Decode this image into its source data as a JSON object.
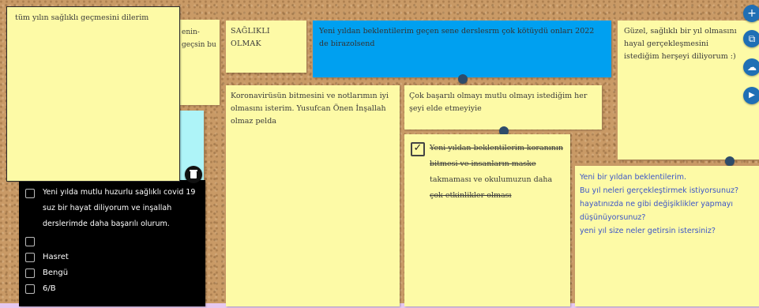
{
  "notes": {
    "top_left": "tüm yılın sağlıklı geçmesini dilerim",
    "behind_fragment_1": "enin-",
    "behind_fragment_2": "geçsin bu",
    "saglikli": "SAĞLIKLI OLMAK",
    "blue": "Yeni yıldan beklentilerim geçen sene derslesrm çok kötüydü  onları 2022 de birazolsend",
    "guzel": "Güzel, sağlıklı bir yıl olmasını hayal gerçekleşmesini istediğim herşeyi diliyorum :)",
    "korona": "Koronavirüsün bitmesini ve notlarımın iyi olmasını isterim.        Yusufcan Önen İnşallah olmaz pelda",
    "cok_basarili": "Çok başarılı olmayı mutlu olmayı istediğim her şeyi elde etmeyiyie",
    "checked_note": {
      "line1": "Yeni yıldan beklentilerim koranının",
      "line2": "bitmesi ve insanların maske",
      "line3": "takmaması ve okulumuzun daha",
      "line4": "çok etkinlikler olması"
    },
    "questions": {
      "q1": "Yeni bir yıldan beklentilerim.",
      "q2": "Bu yıl neleri gerçekleştirmek istiyorsunuz?",
      "q3": "hayatınızda ne gibi değişiklikler yapmayı düşünüyorsunuz?",
      "q4": "yeni yıl size neler getirsin istersiniz?"
    },
    "checklist": {
      "item1": "Yeni yılda mutlu huzurlu  sağlıklı covid 19 suz bir hayat diliyorum ve inşallah derslerimde daha başarılı olurum.",
      "item2": "",
      "item3": "Hasret",
      "item4": "Bengü",
      "item5": "6/B"
    }
  },
  "toolbar": {
    "add": "+",
    "copy": "⧉",
    "cloud": "☁",
    "video": "▶"
  },
  "colors": {
    "note_yellow": "#fdfaa6",
    "blue_note": "#00a0f0",
    "cyan_note": "#aef4f8",
    "black_note": "#000000",
    "question_text": "#3c55c8",
    "pin": "#2e4c6a",
    "fab": "#1f6fb5"
  }
}
